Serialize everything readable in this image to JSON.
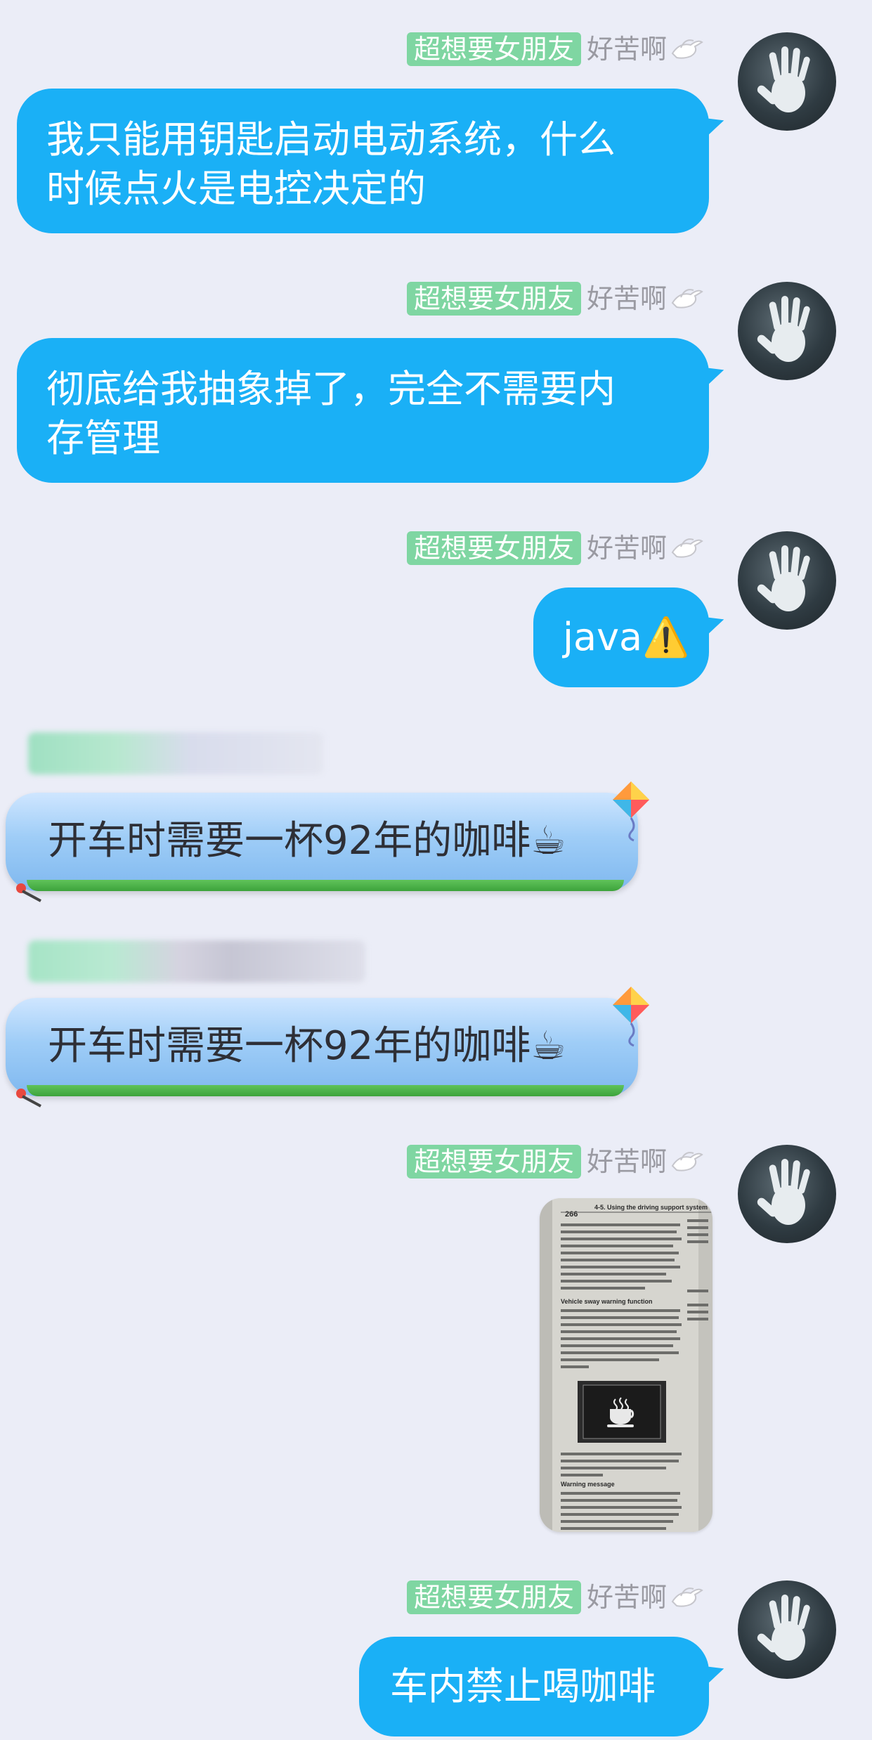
{
  "sender": {
    "title_badge": "超想要女朋友",
    "nickname": "好苦啊"
  },
  "messages": [
    {
      "id": 1,
      "side": "out",
      "text": "我只能用钥匙启动电动系统，什么\n时候点火是电控决定的"
    },
    {
      "id": 2,
      "side": "out",
      "text": "彻底给我抽象掉了，完全不需要内\n存管理"
    },
    {
      "id": 3,
      "side": "out",
      "text": "java⚠️"
    },
    {
      "id": 4,
      "side": "in",
      "text": "开车时需要一杯92年的咖啡☕"
    },
    {
      "id": 5,
      "side": "in",
      "text": "开车时需要一杯92年的咖啡☕"
    },
    {
      "id": 6,
      "side": "out",
      "type": "image",
      "image_text": {
        "page_number": "266",
        "header": "4-5. Using the driving support system",
        "section_title": "Vehicle sway warning function",
        "warning_heading": "Warning message"
      }
    },
    {
      "id": 7,
      "side": "out",
      "text": "车内禁止喝咖啡"
    }
  ],
  "colors": {
    "background": "#ebedf7",
    "outgoing_bubble": "#1ab0f6",
    "title_badge": "#7fd6a2",
    "nickname": "#9a9aa2"
  },
  "icons": [
    "dove-icon",
    "avatar-handprint-icon",
    "kite-icon",
    "pin-icon",
    "coffee-cup-icon"
  ]
}
